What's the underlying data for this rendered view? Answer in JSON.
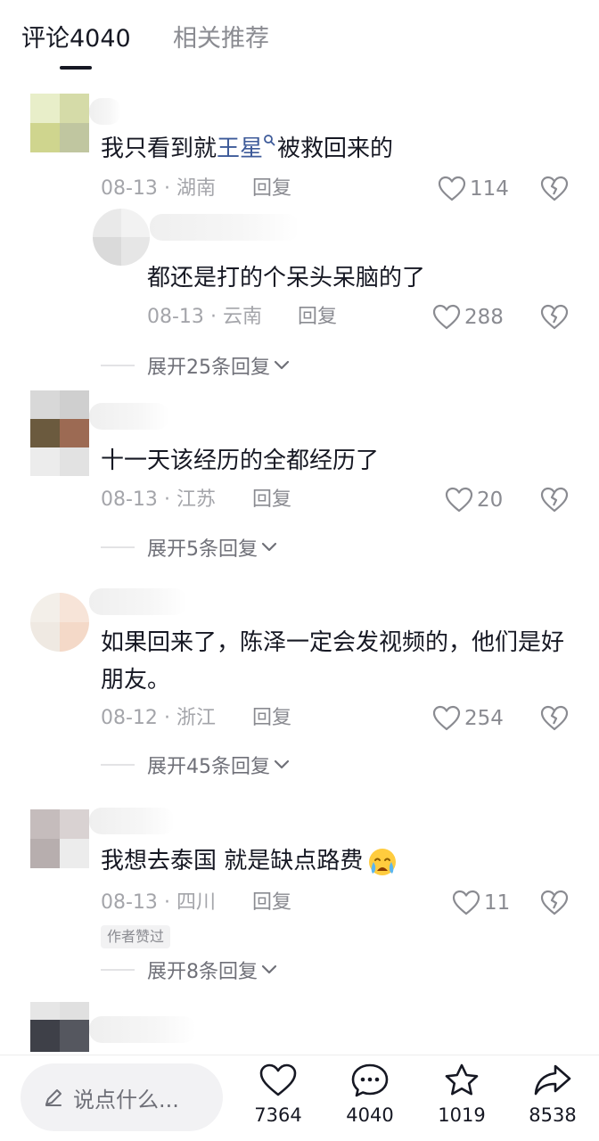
{
  "tabs": {
    "comments": "评论4040",
    "related": "相关推荐"
  },
  "comments": [
    {
      "text_before": "我只看到就",
      "mention": "王星",
      "text_after": "被救回来的",
      "date": "08-13",
      "location": "湖南",
      "reply_label": "回复",
      "likes": "114"
    },
    {
      "text": "都还是打的个呆头呆脑的了",
      "date": "08-13",
      "location": "云南",
      "reply_label": "回复",
      "likes": "288"
    },
    {
      "text": "十一天该经历的全都经历了",
      "date": "08-13",
      "location": "江苏",
      "reply_label": "回复",
      "likes": "20"
    },
    {
      "text": "如果回来了，陈泽一定会发视频的，他们是好朋友。",
      "date": "08-12",
      "location": "浙江",
      "reply_label": "回复",
      "likes": "254"
    },
    {
      "text": "我想去泰国 就是缺点路费",
      "date": "08-13",
      "location": "四川",
      "reply_label": "回复",
      "likes": "11",
      "author_badge": "作者赞过"
    }
  ],
  "expand_replies": [
    "展开25条回复",
    "展开5条回复",
    "展开45条回复",
    "展开8条回复"
  ],
  "meta_separator": "·",
  "bottom": {
    "input_placeholder": "说点什么...",
    "likes": "7364",
    "comments": "4040",
    "favorites": "1019",
    "shares": "8538"
  },
  "icons": [
    "search-icon",
    "heart-icon",
    "dislike-heart-icon",
    "chevron-down-icon",
    "pencil-icon",
    "comment-icon",
    "star-icon",
    "share-icon",
    "crying-emoji-icon"
  ]
}
